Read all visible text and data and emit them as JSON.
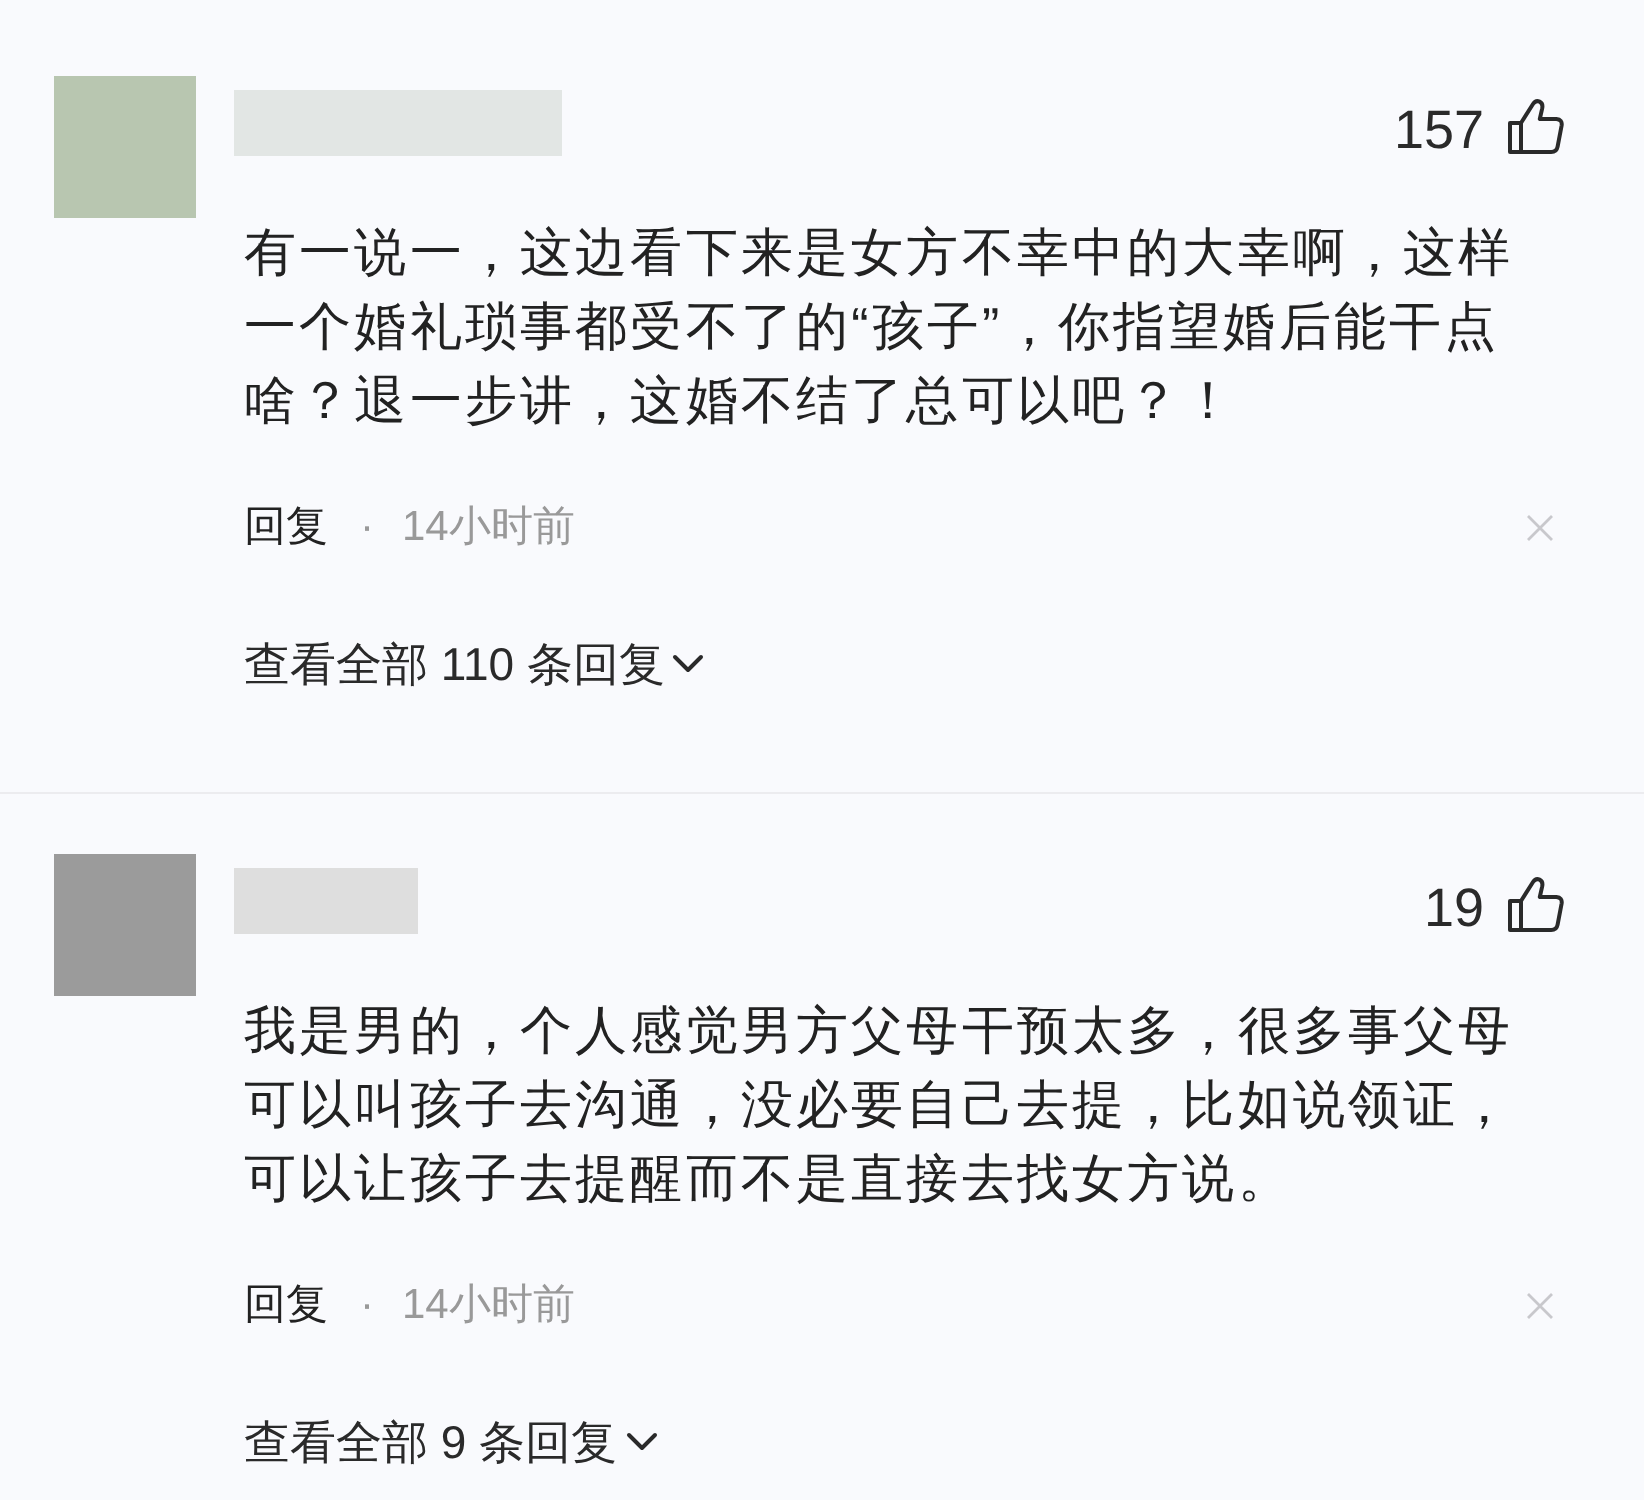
{
  "comments": [
    {
      "avatar": {
        "color": "#b8c6b0"
      },
      "likes": "157",
      "text": "有一说一，这边看下来是女方不幸中的大幸啊，这样一个婚礼琐事都受不了的“孩子”，你指望婚后能干点啥？退一步讲，这婚不结了总可以吧？！",
      "reply_label": "回复",
      "separator": "·",
      "time": "14小时前",
      "view_replies": "查看全部 110 条回复"
    },
    {
      "avatar": {
        "color": "#9b9b9b"
      },
      "likes": "19",
      "text": "我是男的，个人感觉男方父母干预太多，很多事父母可以叫孩子去沟通，没必要自己去提，比如说领证，可以让孩子去提醒而不是直接去找女方说。",
      "reply_label": "回复",
      "separator": "·",
      "time": "14小时前",
      "view_replies": "查看全部 9 条回复"
    }
  ]
}
